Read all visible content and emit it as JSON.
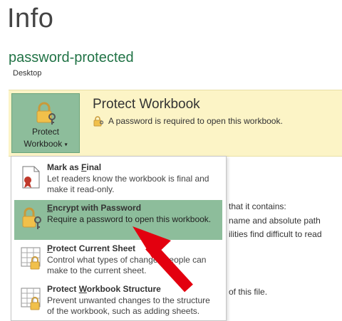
{
  "page": {
    "title": "Info"
  },
  "file": {
    "name": "password-protected",
    "location": "Desktop"
  },
  "protect": {
    "button_label_line1": "Protect",
    "button_label_line2": "Workbook",
    "caret": "▾",
    "heading": "Protect Workbook",
    "status": "A password is required to open this workbook."
  },
  "menu": {
    "items": [
      {
        "title_pre": "Mark as ",
        "title_acc": "F",
        "title_post": "inal",
        "desc": "Let readers know the workbook is final and make it read-only.",
        "icon": "ribbon-document-icon"
      },
      {
        "title_pre": "",
        "title_acc": "E",
        "title_post": "ncrypt with Password",
        "desc": "Require a password to open this workbook.",
        "icon": "lock-key-icon"
      },
      {
        "title_pre": "",
        "title_acc": "P",
        "title_post": "rotect Current Sheet",
        "desc": "Control what types of changes people can make to the current sheet.",
        "icon": "lock-sheet-icon"
      },
      {
        "title_pre": "Protect ",
        "title_acc": "W",
        "title_post": "orkbook Structure",
        "desc": "Prevent unwanted changes to the structure of the workbook, such as adding sheets.",
        "icon": "lock-structure-icon"
      }
    ]
  },
  "background": {
    "line1": "that it contains:",
    "line2": "name and absolute path",
    "line3": "ilities find difficult to read",
    "line4": "of this file."
  },
  "colors": {
    "accent": "#217346",
    "highlight": "#8dbd9b",
    "banner": "#fcf4c6",
    "arrow": "#e3000f"
  }
}
